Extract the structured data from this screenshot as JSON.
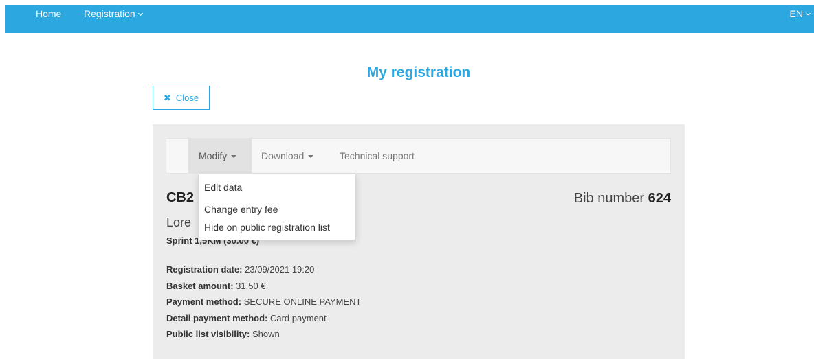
{
  "topnav": {
    "home": "Home",
    "registration": "Registration",
    "language": "EN"
  },
  "page": {
    "title": "My registration",
    "close_label": "Close"
  },
  "toolbar": {
    "modify": "Modify",
    "download": "Download",
    "support": "Technical support"
  },
  "dropdown": {
    "items": [
      "Edit data",
      "Change entry fee",
      "Hide on public registration list"
    ]
  },
  "registration": {
    "code": "CB2",
    "bib_label": "Bib number",
    "bib_number": "624",
    "name": "Lore",
    "race": "Sprint 1,5KM (30.00 €)"
  },
  "details": [
    {
      "label": "Registration date:",
      "value": "23/09/2021 19:20"
    },
    {
      "label": "Basket amount:",
      "value": "31.50 €"
    },
    {
      "label": "Payment method:",
      "value": "SECURE ONLINE PAYMENT"
    },
    {
      "label": "Detail payment method:",
      "value": "Card payment"
    },
    {
      "label": "Public list visibility:",
      "value": "Shown"
    }
  ],
  "colors": {
    "accent": "#2ca7e0",
    "panel": "#ececec"
  }
}
